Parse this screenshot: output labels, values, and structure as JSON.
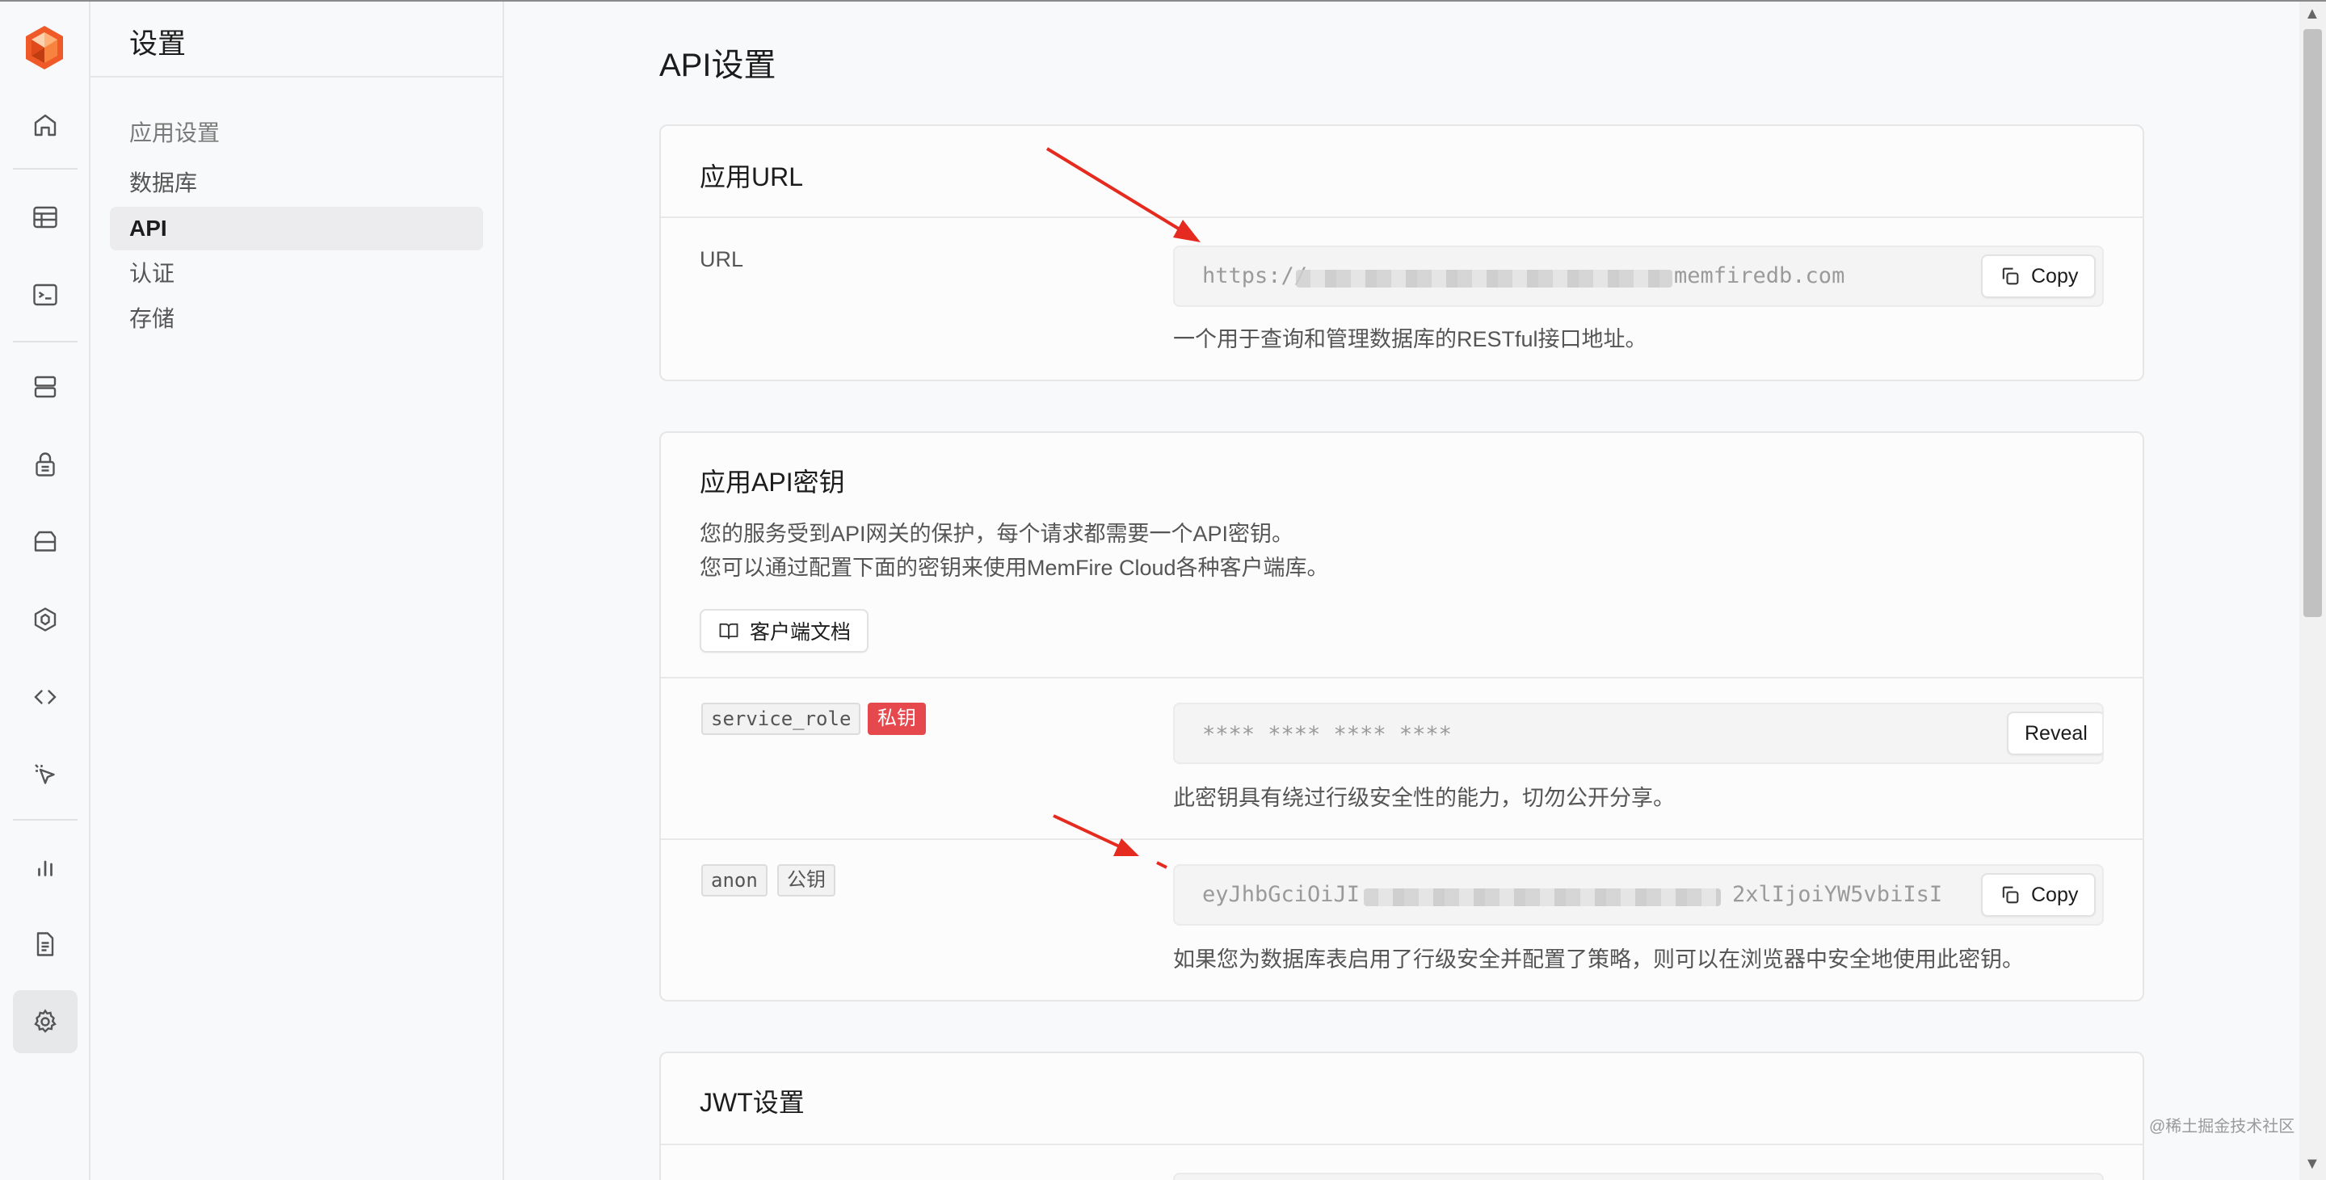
{
  "menu": {
    "title": "设置",
    "group_label": "应用设置",
    "items": [
      "数据库",
      "API",
      "认证",
      "存储"
    ],
    "active_item": "API"
  },
  "main": {
    "page_title": "API设置",
    "url_card": {
      "title": "应用URL",
      "field_label": "URL",
      "url_visible_start": "https://",
      "url_visible_end": "memfiredb.com",
      "copy_label": "Copy",
      "help": "一个用于查询和管理数据库的RESTful接口地址。"
    },
    "keys_card": {
      "title": "应用API密钥",
      "desc_line1": "您的服务受到API网关的保护，每个请求都需要一个API密钥。",
      "desc_line2": "您可以通过配置下面的密钥来使用MemFire Cloud各种客户端库。",
      "docs_button": "客户端文档",
      "service_role": {
        "key_name": "service_role",
        "badge": "私钥",
        "masked_value": "**** **** **** ****",
        "reveal_label": "Reveal",
        "help": "此密钥具有绕过行级安全性的能力，切勿公开分享。"
      },
      "anon": {
        "key_name": "anon",
        "badge": "公钥",
        "value_visible_start": "eyJhbGciOiJI",
        "value_visible_end": "2xlIjoiYW5vbiIsI",
        "copy_label": "Copy",
        "help": "如果您为数据库表启用了行级安全并配置了策略，则可以在浏览器中安全地使用此密钥。"
      }
    },
    "jwt_card": {
      "title": "JWT设置"
    }
  },
  "watermark": "@稀土掘金技术社区",
  "colors": {
    "brand_orange": "#f05a28",
    "danger_red": "#e5484d",
    "annotation_arrow": "#e52a1f"
  }
}
